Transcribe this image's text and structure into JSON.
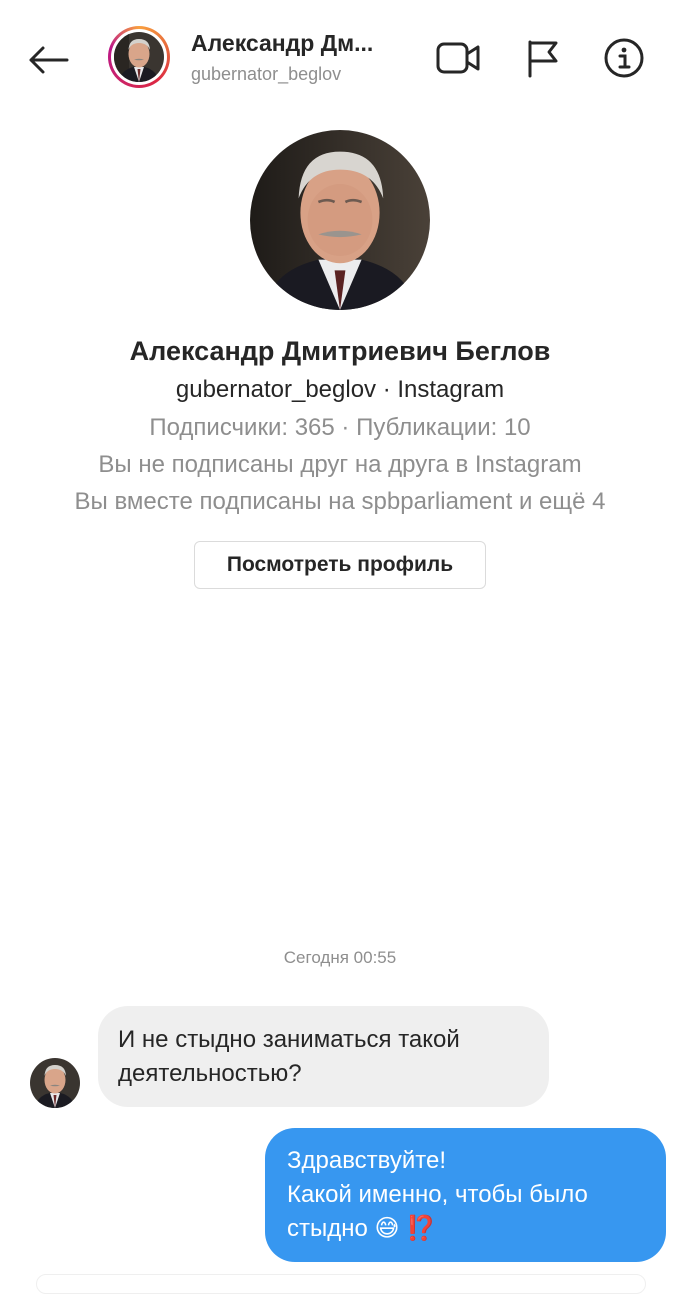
{
  "header": {
    "back_icon": "arrow-left-icon",
    "name": "Александр Дм...",
    "username": "gubernator_beglov",
    "actions": [
      "video-call-icon",
      "flag-icon",
      "info-icon"
    ]
  },
  "profile": {
    "full_name": "Александр Дмитриевич Беглов",
    "handle_line": "gubernator_beglov · Instagram",
    "stats_line": "Подписчики: 365 · Публикации: 10",
    "follow_status": "Вы не подписаны друг на друга в Instagram",
    "mutual_line": "Вы вместе подписаны на spbparliament и ещё 4",
    "view_profile_label": "Посмотреть профиль"
  },
  "chat": {
    "timestamp": "Сегодня 00:55",
    "messages": [
      {
        "direction": "incoming",
        "lines": [
          "И не стыдно заниматься такой",
          "деятельностью?"
        ]
      },
      {
        "direction": "outgoing",
        "lines": [
          "Здравствуйте!",
          "Какой именно, чтобы было",
          "стыдно 😅 ⁉️"
        ]
      }
    ]
  },
  "colors": {
    "outgoing_bubble": "#3797f0",
    "incoming_bubble": "#efefef",
    "text_primary": "#262626",
    "text_secondary": "#8e8e8e"
  }
}
